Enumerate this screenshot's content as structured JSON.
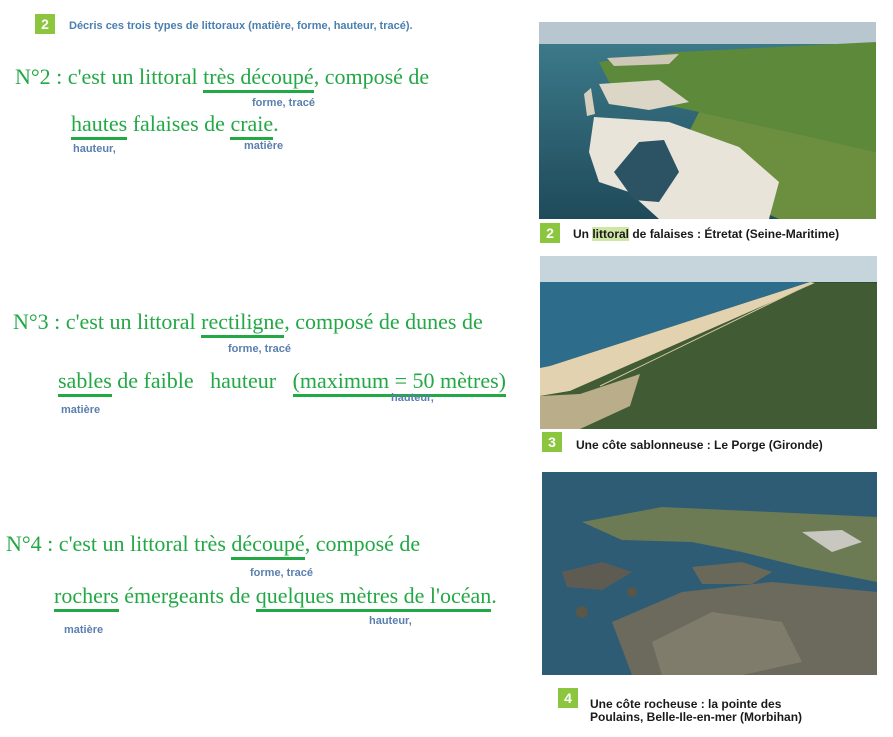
{
  "header": {
    "badge": "2",
    "instruction": "Décris ces trois types de littoraux (matière, forme, hauteur, tracé)."
  },
  "answers": [
    {
      "line1": [
        "N°2 : c'est un littoral ",
        "très découpé",
        ", composé de"
      ],
      "line2": [
        "hautes",
        " falaises de ",
        "craie",
        "."
      ],
      "notes": [
        "forme, tracé",
        "hauteur,",
        "matière"
      ]
    },
    {
      "line1": [
        "N°3 : c'est un littoral ",
        "rectiligne",
        ", composé de dunes de"
      ],
      "line2": [
        "sables",
        " de faible   hauteur   ",
        "(maximum = 50 mètres)"
      ],
      "notes": [
        "forme, tracé",
        "matière",
        "hauteur,"
      ]
    },
    {
      "line1": [
        "N°4 : c'est un littoral très ",
        "découpé",
        ", composé de"
      ],
      "line2": [
        "rochers",
        " émergeants de ",
        "quelques mètres de l'océan",
        "."
      ],
      "notes": [
        "forme, tracé",
        "matière",
        "hauteur,"
      ]
    }
  ],
  "photos": [
    {
      "badge": "2",
      "caption_pre": "Un ",
      "caption_hl": "littoral",
      "caption_post": " de falaises : Étretat (Seine-Maritime)"
    },
    {
      "badge": "3",
      "caption": "Une côte sablonneuse : Le Porge (Gironde)"
    },
    {
      "badge": "4",
      "caption_line1": "Une côte rocheuse : la pointe des",
      "caption_line2": "Poulains, Belle-Ile-en-mer (Morbihan)"
    }
  ],
  "colors": {
    "answer_text": "#22a845",
    "notes": "#5a7fae",
    "badge": "#8cc63f",
    "instruction": "#4a7fb0"
  }
}
